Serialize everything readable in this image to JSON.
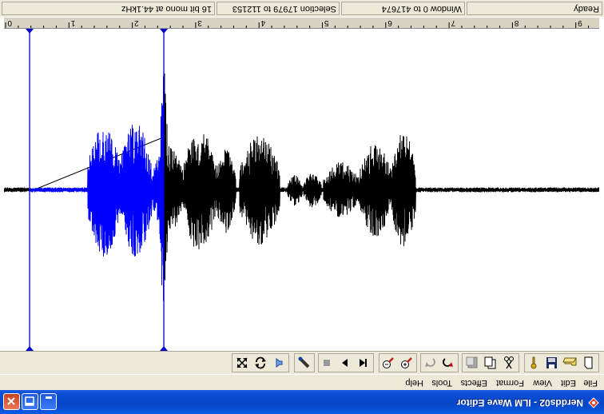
{
  "window": {
    "title": "Nerdds02 - ILM Wave Editor",
    "controls": [
      "minimize",
      "maximize",
      "close"
    ]
  },
  "menu": {
    "items": [
      "File",
      "Edit",
      "View",
      "Format",
      "Effects",
      "Tools",
      "Help"
    ]
  },
  "toolbar": {
    "buttons": [
      "new-document-icon",
      "open-file-icon",
      "save-icon",
      "properties-icon",
      "cut-icon",
      "copy-icon",
      "paste-icon",
      "undo-icon",
      "redo-icon",
      "zoom-in-icon",
      "zoom-out-icon",
      "skip-to-start-icon",
      "play-icon",
      "stop-icon",
      "record-icon",
      "speaker-icon",
      "loop-icon",
      "fit-window-icon"
    ]
  },
  "ruler": {
    "labels": [
      "0",
      "1",
      "2",
      "3",
      "4",
      "5",
      "6",
      "7",
      "8",
      "9"
    ]
  },
  "status": {
    "ready": "Ready",
    "format": "16 bit mono at 44.1kHz",
    "selection": "Selection 17979 to 112153",
    "window": "Window 0 to 417674"
  },
  "waveform": {
    "selection_color": "#0000ff",
    "wave_color": "#000000",
    "selection_start": 17979,
    "selection_end": 112153,
    "window_end": 417674
  }
}
